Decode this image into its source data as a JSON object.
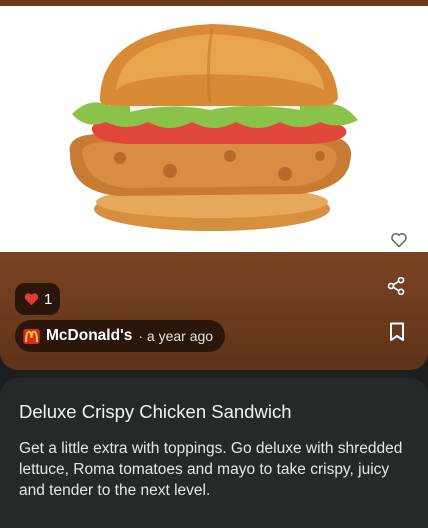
{
  "likes": {
    "count": "1"
  },
  "source": {
    "name": "McDonald's",
    "time": "· a year ago"
  },
  "item": {
    "title": "Deluxe Crispy Chicken Sandwich",
    "description": "Get a little extra with toppings. Go deluxe with shredded lettuce, Roma tomatoes and mayo to take crispy, juicy and tender to the next level."
  },
  "colors": {
    "accent_brown": "#7a4424",
    "pill_dark": "#2a160b",
    "panel_dark": "#24292c",
    "heart_red": "#e53935",
    "mcd_red": "#da291c",
    "mcd_yellow": "#ffc72c"
  },
  "icons": {
    "favorite": "heart-outline-icon",
    "share": "share-icon",
    "save": "bookmark-icon",
    "like": "heart-filled-icon",
    "brand": "mcdonalds-logo-icon"
  }
}
